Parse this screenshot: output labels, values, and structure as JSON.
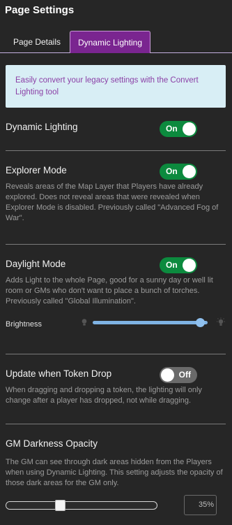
{
  "header": {
    "title": "Page Settings"
  },
  "tabs": [
    {
      "label": "Page Details",
      "active": false
    },
    {
      "label": "Dynamic Lighting",
      "active": true
    }
  ],
  "info": {
    "text": "Easily convert your legacy settings with the Convert Lighting tool"
  },
  "dynamic_lighting": {
    "title": "Dynamic Lighting",
    "toggle": "On",
    "enabled": true
  },
  "explorer_mode": {
    "title": "Explorer Mode",
    "toggle": "On",
    "enabled": true,
    "description": "Reveals areas of the Map Layer that Players have already explored. Does not reveal areas that were revealed when Explorer Mode is disabled. Previously called \"Advanced Fog of War\"."
  },
  "daylight_mode": {
    "title": "Daylight Mode",
    "toggle": "On",
    "enabled": true,
    "description": "Adds Light to the whole Page, good for a sunny day or well lit room or GMs who don't want to place a bunch of torches. Previously called \"Global Illumination\".",
    "brightness_label": "Brightness",
    "brightness_fraction": 0.97
  },
  "update_token_drop": {
    "title": "Update when Token Drop",
    "toggle": "Off",
    "enabled": false,
    "description": "When dragging and dropping a token, the lighting will only change after a player has dropped, not while dragging."
  },
  "gm_darkness": {
    "title": "GM Darkness Opacity",
    "description": "The GM can see through dark areas hidden from the Players when using Dynamic Lighting. This setting adjusts the opacity of those dark areas for the GM only.",
    "value_percent": 35,
    "value_label": "35%"
  },
  "icons": {
    "dim": "bulb-dim-icon",
    "bright": "bulb-bright-icon"
  },
  "colors": {
    "background": "#262626",
    "tab_active": "#7a2590",
    "toggle_on": "#0c8a3e",
    "toggle_off": "#6a6a6a",
    "info_bg": "#d8eef5",
    "info_text": "#8b3fa6",
    "slider_blue": "#7fb3e4"
  }
}
